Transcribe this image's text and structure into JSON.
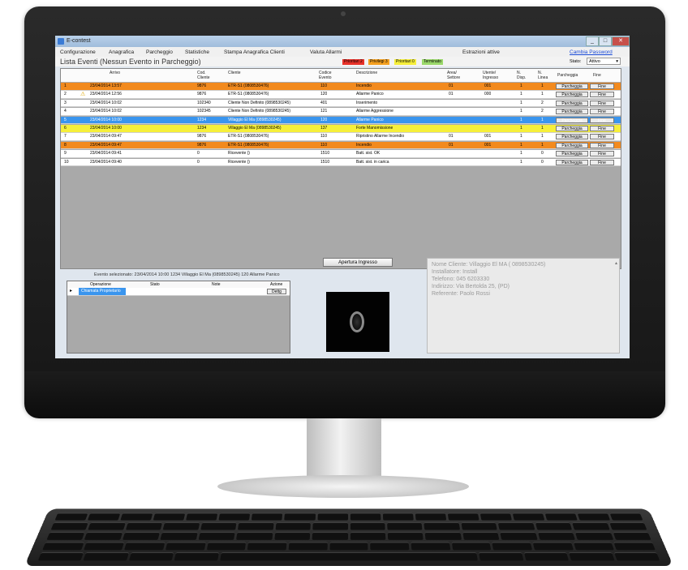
{
  "window": {
    "title": "E-contest",
    "min_label": "_",
    "max_label": "□",
    "close_label": "✕"
  },
  "menu": {
    "items": [
      "Configurazione",
      "Anagrafica",
      "Parcheggio",
      "Statistiche",
      "Stampa Anagrafica Clienti",
      "Valuta Allarmi"
    ],
    "center_text": "Estrazioni attive",
    "right_link": "Cambia Password"
  },
  "header": {
    "list_title": "Lista Eventi (Nessun Evento in Parcheggio)",
    "legend": [
      {
        "label": "Prioritari 2",
        "color": "#e8322a"
      },
      {
        "label": "Privilegi 3",
        "color": "#f4a020"
      },
      {
        "label": "Prioritari 0",
        "color": "#f6ef3a"
      },
      {
        "label": "Terminato",
        "color": "#9ad86a"
      }
    ],
    "state_label": "Stato:",
    "state_value": "Attivo"
  },
  "grid": {
    "columns": [
      "Arrivo",
      "Cod. Cliente",
      "Cliente",
      "Codice Evento",
      "Descrizione",
      "Area/ Settore",
      "Utente/ Ingresso",
      "N. Disp.",
      "N. Linea",
      "Parcheggia",
      "Fine"
    ],
    "rows": [
      {
        "n": "1",
        "arrivo": "23/04/2014 13:57",
        "cod": "9876",
        "cliente": "ETR-S1 (0808530476)",
        "codev": "110",
        "desc": "Incendio",
        "area": "01",
        "utente": "001",
        "disp": "1",
        "linea": "1",
        "bg": "#f28a1e",
        "warn": false
      },
      {
        "n": "2",
        "arrivo": "23/04/2014 12:56",
        "cod": "9876",
        "cliente": "ETR-S1 (0808530476)",
        "codev": "120",
        "desc": "Allarme Panico",
        "area": "01",
        "utente": "000",
        "disp": "1",
        "linea": "1",
        "bg": "#ffffff",
        "warn": true
      },
      {
        "n": "3",
        "arrivo": "23/04/2014 10:02",
        "cod": "102340",
        "cliente": "Cliente Non Definito (0898530245)",
        "codev": "401",
        "desc": "Inserimento",
        "area": "",
        "utente": "",
        "disp": "1",
        "linea": "2",
        "bg": "#ffffff",
        "warn": false
      },
      {
        "n": "4",
        "arrivo": "23/04/2014 10:02",
        "cod": "102345",
        "cliente": "Cliente Non Definito (0898530245)",
        "codev": "121",
        "desc": "Allarme Aggressione",
        "area": "",
        "utente": "",
        "disp": "1",
        "linea": "2",
        "bg": "#ffffff",
        "warn": false
      },
      {
        "n": "5",
        "arrivo": "23/04/2014 10:00",
        "cod": "1234",
        "cliente": "Villaggio El Ma (0898530245)",
        "codev": "120",
        "desc": "Allarme Panico",
        "area": "",
        "utente": "",
        "disp": "1",
        "linea": "1",
        "bg": "#3a95ee",
        "warn": false
      },
      {
        "n": "6",
        "arrivo": "23/04/2014 10:00",
        "cod": "1234",
        "cliente": "Villaggio El Ma (0898530245)",
        "codev": "137",
        "desc": "Forte Manomissione",
        "area": "",
        "utente": "",
        "disp": "1",
        "linea": "1",
        "bg": "#f6ef3a",
        "warn": false
      },
      {
        "n": "7",
        "arrivo": "23/04/2014 09:47",
        "cod": "9876",
        "cliente": "ETR-S1 (0808530476)",
        "codev": "110",
        "desc": "Ripristino Allarme Incendio",
        "area": "01",
        "utente": "001",
        "disp": "1",
        "linea": "1",
        "bg": "#ffffff",
        "warn": false
      },
      {
        "n": "8",
        "arrivo": "23/04/2014 09:47",
        "cod": "9876",
        "cliente": "ETR-S1 (0808530476)",
        "codev": "110",
        "desc": "Incendio",
        "area": "01",
        "utente": "001",
        "disp": "1",
        "linea": "1",
        "bg": "#f28a1e",
        "warn": false
      },
      {
        "n": "9",
        "arrivo": "23/04/2014 09:41",
        "cod": "0",
        "cliente": "Ricevente ()",
        "codev": "1510",
        "desc": "Batt. sist. OK",
        "area": "",
        "utente": "",
        "disp": "1",
        "linea": "0",
        "bg": "#ffffff",
        "warn": false
      },
      {
        "n": "10",
        "arrivo": "23/04/2014 09:40",
        "cod": "0",
        "cliente": "Ricevente ()",
        "codev": "1510",
        "desc": "Batt. sist. in carica",
        "area": "",
        "utente": "",
        "disp": "1",
        "linea": "0",
        "bg": "#ffffff",
        "warn": false
      }
    ],
    "park_label": "Parcheggia",
    "end_label": "Fine"
  },
  "selected": {
    "info": "Evento selezionato: 23/04/2014 10:00  1234  Villaggio El Ma (0898530245)  120  Allarme Panico"
  },
  "ops": {
    "columns": [
      "Operazione",
      "Stato",
      "Note",
      "Azione"
    ],
    "row_operation": "Chiamata Proprietario",
    "row_action": "Dettg"
  },
  "actions": {
    "open_gate": "Apertura Ingresso"
  },
  "info_panel": {
    "lines": [
      "Nome Cliente: Villaggio El MA ( 0898530245)",
      "Installatore: Install",
      "Telefono: 045 6203330",
      "Indirizzo: Via Bertolda 25, (PD)",
      "Referente: Paolo Rossi"
    ]
  }
}
